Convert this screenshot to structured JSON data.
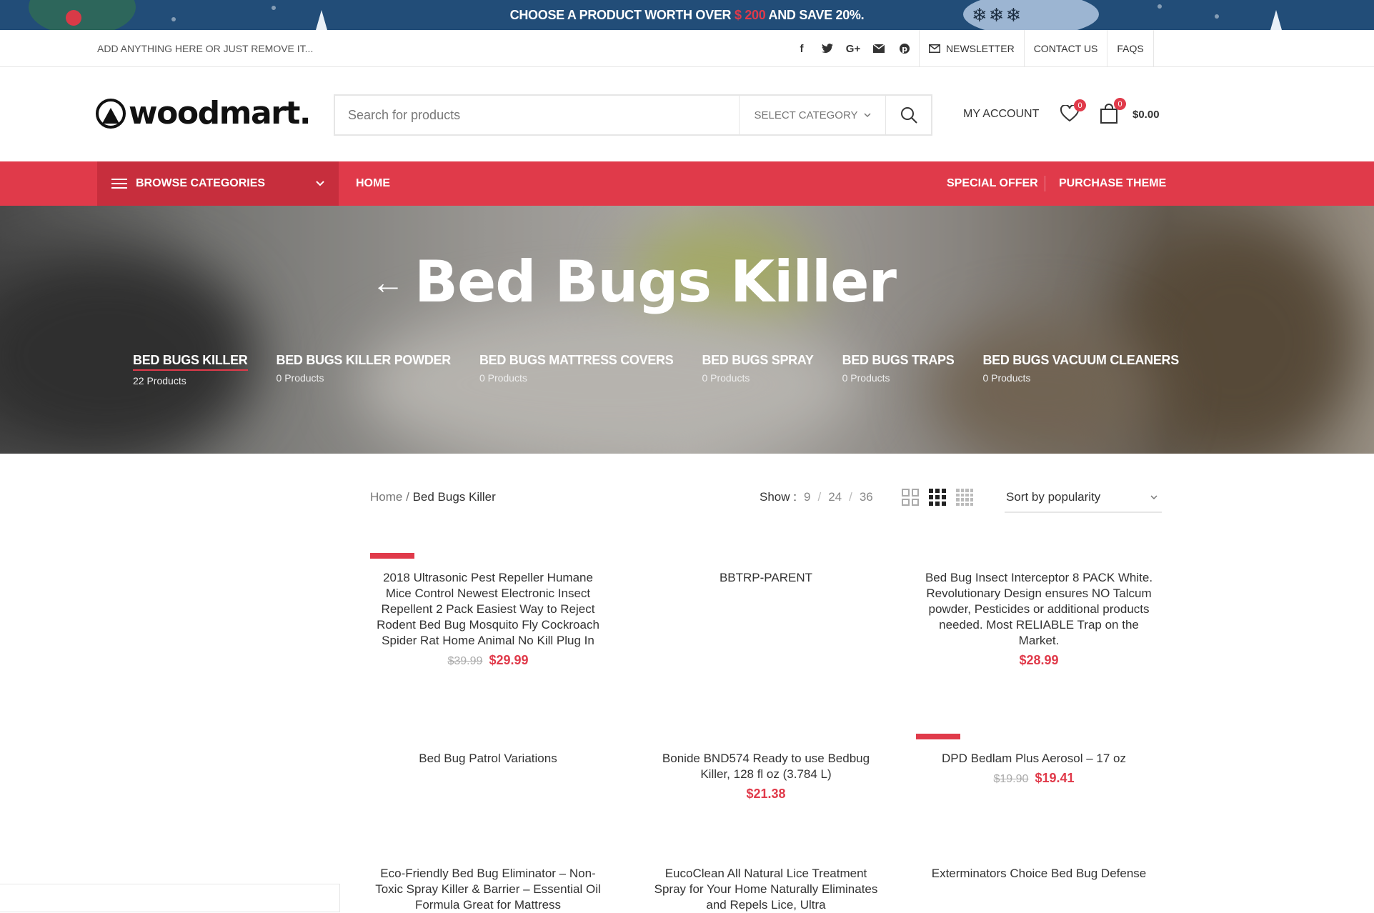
{
  "promo": {
    "before": "CHOOSE A PRODUCT WORTH OVER",
    "amount": "$ 200",
    "after": "AND SAVE 20%."
  },
  "topbar": {
    "tagline": "ADD ANYTHING HERE OR JUST REMOVE IT...",
    "socials": [
      "facebook-icon",
      "twitter-icon",
      "google-plus-icon",
      "email-icon",
      "pinterest-icon"
    ],
    "links": {
      "newsletter": "NEWSLETTER",
      "contact": "CONTACT US",
      "faqs": "FAQS"
    }
  },
  "header": {
    "logo": "woodmart.",
    "search_placeholder": "Search for products",
    "select_category": "SELECT CATEGORY",
    "my_account": "MY ACCOUNT",
    "wishlist_count": "0",
    "cart_count": "0",
    "cart_total": "$0.00"
  },
  "nav": {
    "browse": "BROWSE CATEGORIES",
    "home": "HOME",
    "special_offer": "SPECIAL OFFER",
    "purchase_theme": "PURCHASE THEME"
  },
  "hero": {
    "title": "Bed Bugs Killer",
    "categories": [
      {
        "name": "BED BUGS KILLER",
        "count": "22 Products"
      },
      {
        "name": "BED BUGS KILLER POWDER",
        "count": "0 Products"
      },
      {
        "name": "BED BUGS MATTRESS COVERS",
        "count": "0 Products"
      },
      {
        "name": "BED BUGS SPRAY",
        "count": "0 Products"
      },
      {
        "name": "BED BUGS TRAPS",
        "count": "0 Products"
      },
      {
        "name": "BED BUGS VACUUM CLEANERS",
        "count": "0 Products"
      }
    ]
  },
  "toolbar": {
    "breadcrumb_home": "Home",
    "breadcrumb_sep": "/",
    "breadcrumb_current": "Bed Bugs Killer",
    "show_label": "Show :",
    "show_options": [
      "9",
      "24",
      "36"
    ],
    "sort_label": "Sort by popularity"
  },
  "products": [
    {
      "name": "2018 Ultrasonic Pest Repeller Humane Mice Control Newest Electronic Insect Repellent 2 Pack Easiest Way to Reject Rodent Bed Bug Mosquito Fly Cockroach Spider Rat Home Animal No Kill Plug In",
      "old_price": "$39.99",
      "price": "$29.99"
    },
    {
      "name": "BBTRP-PARENT",
      "old_price": "",
      "price": ""
    },
    {
      "name": "Bed Bug Insect Interceptor 8 PACK White. Revolutionary Design ensures NO Talcum powder, Pesticides or additional products needed. Most RELIABLE Trap on the Market.",
      "old_price": "",
      "price": "$28.99"
    },
    {
      "name": "Bed Bug Patrol Variations",
      "old_price": "",
      "price": ""
    },
    {
      "name": "Bonide BND574 Ready to use Bedbug Killer, 128 fl oz (3.784 L)",
      "old_price": "",
      "price": "$21.38"
    },
    {
      "name": "DPD Bedlam Plus Aerosol – 17 oz",
      "old_price": "$19.90",
      "price": "$19.41"
    },
    {
      "name": "Eco-Friendly Bed Bug Eliminator – Non-Toxic Spray Killer & Barrier – Essential Oil Formula Great for Mattress",
      "old_price": "",
      "price": ""
    },
    {
      "name": "EucoClean All Natural Lice Treatment Spray for Your Home Naturally Eliminates and Repels Lice, Ultra",
      "old_price": "",
      "price": ""
    },
    {
      "name": "Exterminators Choice Bed Bug Defense",
      "old_price": "",
      "price": ""
    }
  ],
  "colors": {
    "accent": "#e03a4a",
    "promo_bg": "#224d78"
  }
}
